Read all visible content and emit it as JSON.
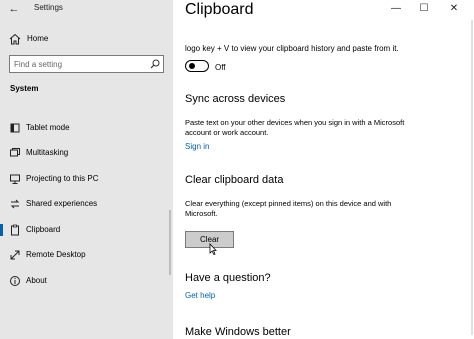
{
  "window": {
    "app_title": "Settings",
    "controls": {
      "minimize": "—",
      "maximize": "☐",
      "close": "✕"
    }
  },
  "sidebar": {
    "back_icon": "←",
    "home_label": "Home",
    "search_placeholder": "Find a setting",
    "section_header": "System",
    "items": [
      {
        "label": "Tablet mode",
        "icon": "tablet-icon"
      },
      {
        "label": "Multitasking",
        "icon": "multitasking-icon"
      },
      {
        "label": "Projecting to this PC",
        "icon": "projecting-icon"
      },
      {
        "label": "Shared experiences",
        "icon": "shared-experiences-icon"
      },
      {
        "label": "Clipboard",
        "icon": "clipboard-icon",
        "active": true
      },
      {
        "label": "Remote Desktop",
        "icon": "remote-desktop-icon"
      },
      {
        "label": "About",
        "icon": "about-icon"
      }
    ]
  },
  "main": {
    "title": "Clipboard",
    "cut_text": "logo key + V to view your clipboard history and paste from it.",
    "history_toggle": {
      "state": "Off"
    },
    "sync": {
      "heading": "Sync across devices",
      "description": "Paste text on your other devices when you sign in with a Microsoft account or work account.",
      "link": "Sign in"
    },
    "clear": {
      "heading": "Clear clipboard data",
      "description": "Clear everything (except pinned items) on this device and with Microsoft.",
      "button": "Clear"
    },
    "question": {
      "heading": "Have a question?",
      "link": "Get help"
    },
    "better": {
      "heading": "Make Windows better"
    }
  },
  "colors": {
    "accent": "#0063b1",
    "sidebar_bg": "#e6e6e6",
    "button_bg": "#cccccc"
  }
}
